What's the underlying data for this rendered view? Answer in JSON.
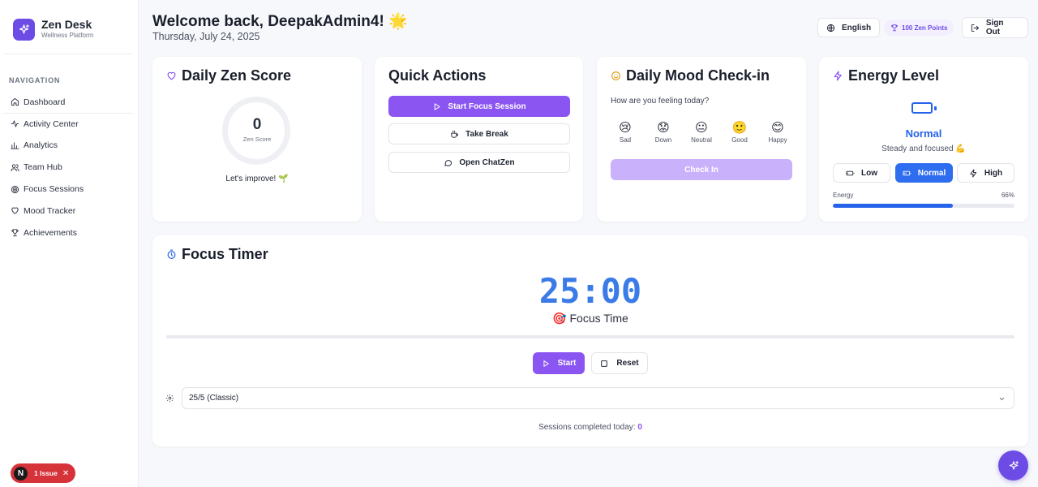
{
  "brand": {
    "name": "Zen Desk",
    "subtitle": "Wellness Platform"
  },
  "nav": {
    "title": "NAVIGATION",
    "items": [
      {
        "label": "Dashboard",
        "icon": "home-icon"
      },
      {
        "label": "Activity Center",
        "icon": "activity-icon"
      },
      {
        "label": "Analytics",
        "icon": "chart-icon"
      },
      {
        "label": "Team Hub",
        "icon": "users-icon"
      },
      {
        "label": "Focus Sessions",
        "icon": "target-icon"
      },
      {
        "label": "Mood Tracker",
        "icon": "heart-icon"
      },
      {
        "label": "Achievements",
        "icon": "trophy-icon"
      }
    ]
  },
  "header": {
    "welcome": "Welcome back, DeepakAdmin4! 🌟",
    "date": "Thursday, July 24, 2025",
    "language": "English",
    "points": "100 Zen Points",
    "sign_out": "Sign Out"
  },
  "zen_score": {
    "title": "Daily Zen Score",
    "value": "0",
    "label": "Zen Score",
    "message": "Let's improve! 🌱"
  },
  "quick_actions": {
    "title": "Quick Actions",
    "start_focus": "Start Focus Session",
    "take_break": "Take Break",
    "open_chat": "Open ChatZen"
  },
  "mood": {
    "title": "Daily Mood Check-in",
    "question": "How are you feeling today?",
    "options": [
      {
        "emoji": "😢",
        "label": "Sad"
      },
      {
        "emoji": "😟",
        "label": "Down"
      },
      {
        "emoji": "😐",
        "label": "Neutral"
      },
      {
        "emoji": "🙂",
        "label": "Good"
      },
      {
        "emoji": "😊",
        "label": "Happy"
      }
    ],
    "check_in": "Check In"
  },
  "energy": {
    "title": "Energy Level",
    "state": "Normal",
    "description": "Steady and focused 💪",
    "levels": [
      "Low",
      "Normal",
      "High"
    ],
    "selected": "Normal",
    "bar_label": "Energy",
    "percent_text": "66%",
    "percent": 66,
    "color": "#2563eb"
  },
  "focus_timer": {
    "title": "Focus Timer",
    "time": "25:00",
    "mode": "🎯 Focus Time",
    "start": "Start",
    "reset": "Reset",
    "preset": "25/5 (Classic)",
    "sessions_label": "Sessions completed today:",
    "sessions_count": "0"
  },
  "issue_badge": {
    "letter": "N",
    "text": "1 Issue"
  },
  "colors": {
    "accent": "#8b55f2",
    "brand": "#6d4ce6",
    "energy_active": "#2f6df0",
    "timer": "#3b7be8"
  }
}
